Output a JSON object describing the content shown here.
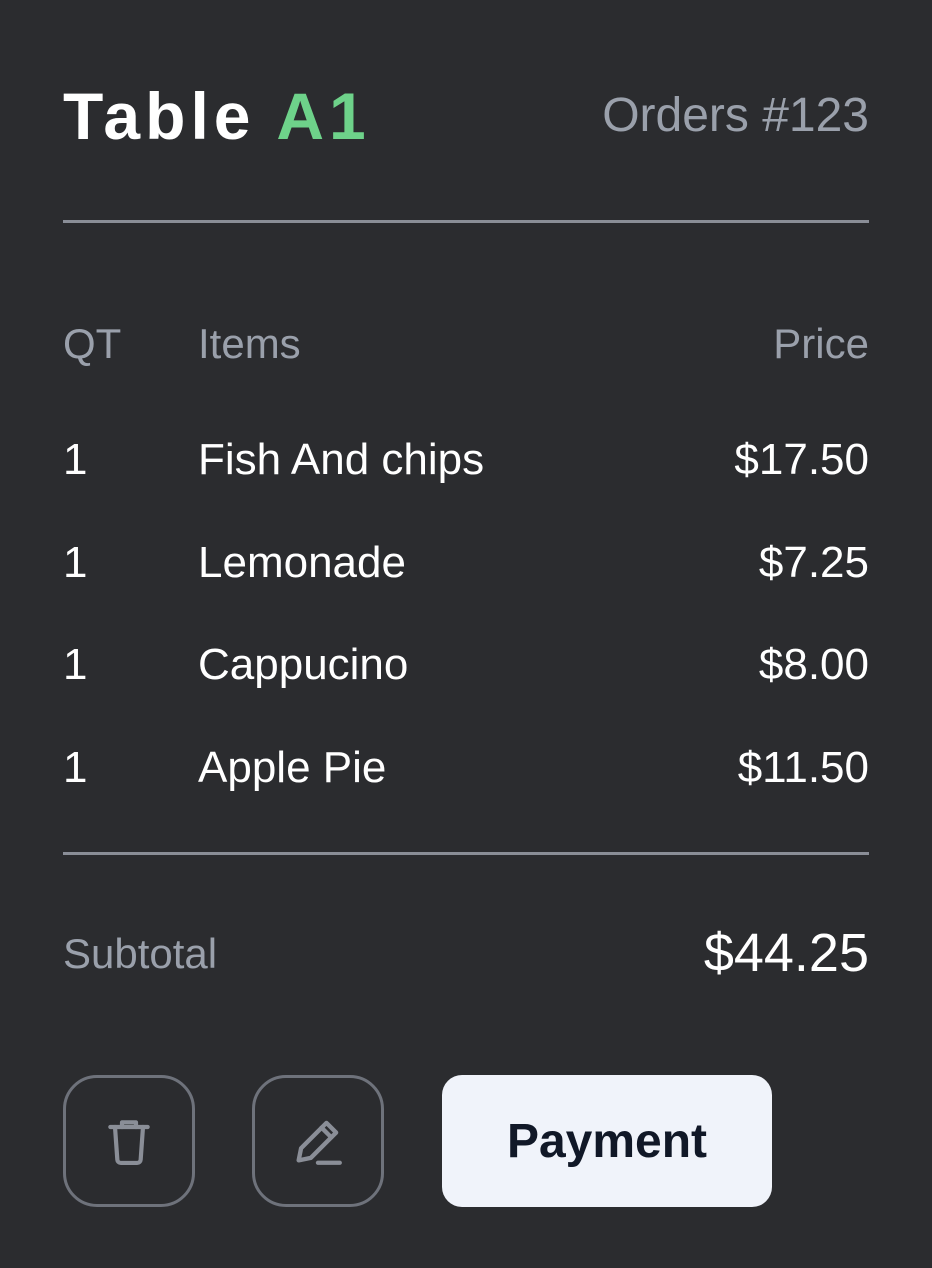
{
  "header": {
    "title_prefix": "Table",
    "title_accent": "A1",
    "order_label": "Orders #123"
  },
  "table": {
    "columns": {
      "qt": "QT",
      "items": "Items",
      "price": "Price"
    },
    "rows": [
      {
        "qt": "1",
        "item": "Fish And chips",
        "price": "$17.50"
      },
      {
        "qt": "1",
        "item": "Lemonade",
        "price": "$7.25"
      },
      {
        "qt": "1",
        "item": "Cappucino",
        "price": "$8.00"
      },
      {
        "qt": "1",
        "item": "Apple Pie",
        "price": "$11.50"
      }
    ]
  },
  "summary": {
    "subtotal_label": "Subtotal",
    "subtotal_value": "$44.25"
  },
  "actions": {
    "delete_icon": "trash-icon",
    "edit_icon": "pencil-icon",
    "payment_label": "Payment"
  },
  "colors": {
    "background": "#2b2c2f",
    "accent": "#6ed28a",
    "muted_text": "#9aa0ab",
    "button_bg": "#f0f3fa"
  }
}
